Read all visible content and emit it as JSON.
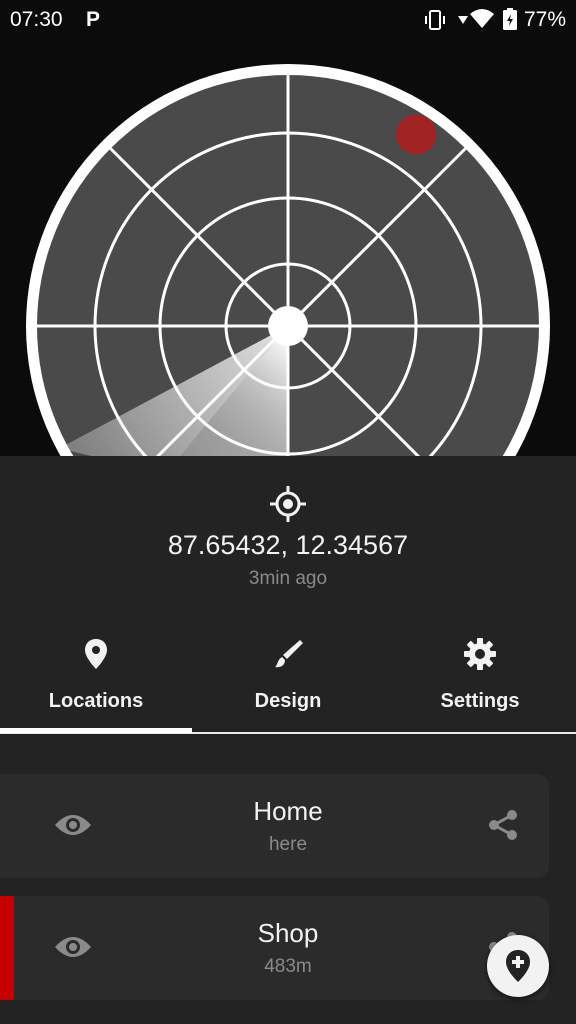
{
  "status_bar": {
    "time": "07:30",
    "notification_label": "P",
    "battery": "77%",
    "icons": [
      "vibrate-icon",
      "signal-icon",
      "wifi-icon",
      "battery-icon"
    ]
  },
  "radar": {
    "target_color": "#b01c1c"
  },
  "location_info": {
    "coordinates": "87.65432, 12.34567",
    "updated": "3min ago",
    "icon": "crosshair-icon"
  },
  "tabs": [
    {
      "label": "Locations",
      "icon": "location-pin-icon",
      "selected": true
    },
    {
      "label": "Design",
      "icon": "brush-icon",
      "selected": false
    },
    {
      "label": "Settings",
      "icon": "gear-icon",
      "selected": false
    }
  ],
  "locations": [
    {
      "name": "Home",
      "distance": "here",
      "accent": null
    },
    {
      "name": "Shop",
      "distance": "483m",
      "accent": "#c60000"
    }
  ],
  "fab": {
    "icon": "add-location-icon"
  },
  "colors": {
    "panel": "#232323",
    "card": "#2b2b2b",
    "accent": "#c60000"
  }
}
